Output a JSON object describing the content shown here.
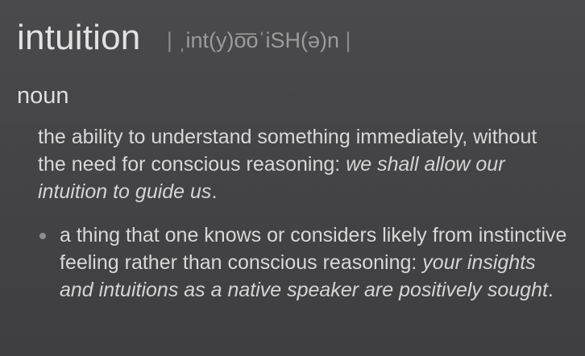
{
  "entry": {
    "headword": "intuition",
    "pronunciation": {
      "open_bar": "|",
      "text": "ˌint(y)o͞oˈiSH(ə)n",
      "close_bar": "|"
    },
    "part_of_speech": "noun",
    "senses": [
      {
        "definition": "the ability to understand something immediately, without the need for conscious reasoning:",
        "example": "we shall allow our intuition to guide us",
        "end_punct": "."
      }
    ],
    "subsenses": [
      {
        "bullet_icon": "bullet-dot-icon",
        "definition": "a thing that one knows or considers likely from instinctive feeling rather than conscious reasoning:",
        "example": "your insights and intuitions as a native speaker are positively sought",
        "end_punct": "."
      }
    ]
  }
}
